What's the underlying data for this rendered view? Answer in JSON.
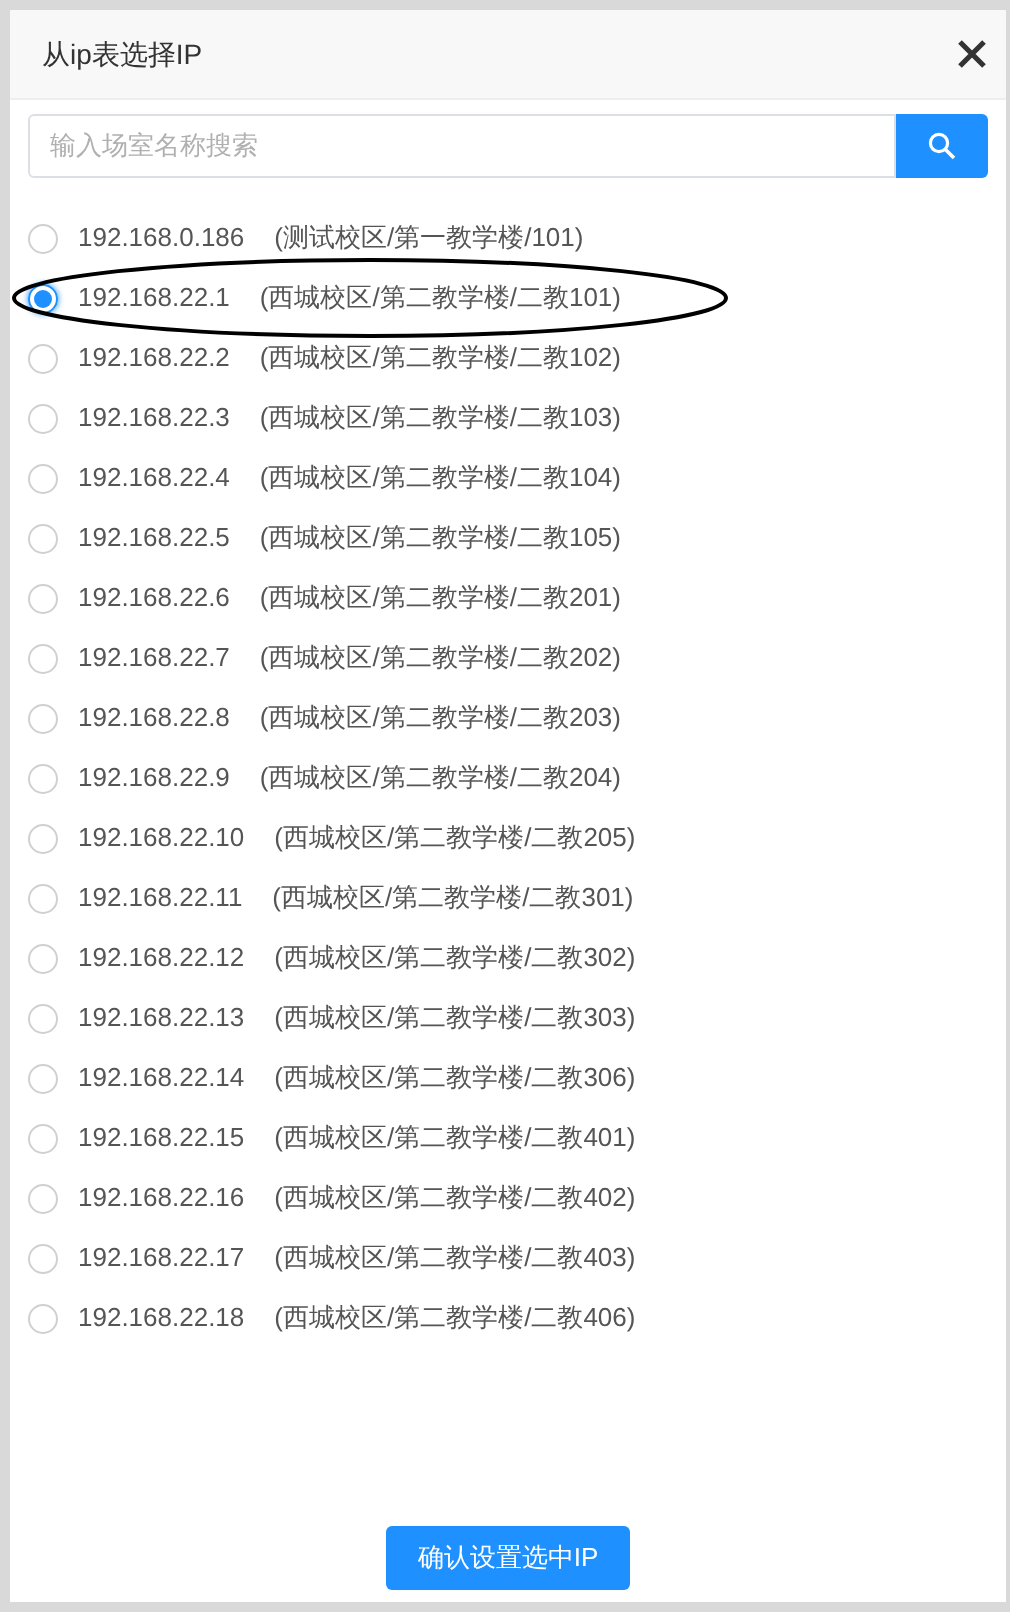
{
  "dialog": {
    "title": "从ip表选择IP",
    "search": {
      "placeholder": "输入场室名称搜索"
    },
    "options": [
      {
        "ip": "192.168.0.186",
        "location": "(测试校区/第一教学楼/101)",
        "selected": false
      },
      {
        "ip": "192.168.22.1",
        "location": "(西城校区/第二教学楼/二教101)",
        "selected": true
      },
      {
        "ip": "192.168.22.2",
        "location": "(西城校区/第二教学楼/二教102)",
        "selected": false
      },
      {
        "ip": "192.168.22.3",
        "location": "(西城校区/第二教学楼/二教103)",
        "selected": false
      },
      {
        "ip": "192.168.22.4",
        "location": "(西城校区/第二教学楼/二教104)",
        "selected": false
      },
      {
        "ip": "192.168.22.5",
        "location": "(西城校区/第二教学楼/二教105)",
        "selected": false
      },
      {
        "ip": "192.168.22.6",
        "location": "(西城校区/第二教学楼/二教201)",
        "selected": false
      },
      {
        "ip": "192.168.22.7",
        "location": "(西城校区/第二教学楼/二教202)",
        "selected": false
      },
      {
        "ip": "192.168.22.8",
        "location": "(西城校区/第二教学楼/二教203)",
        "selected": false
      },
      {
        "ip": "192.168.22.9",
        "location": "(西城校区/第二教学楼/二教204)",
        "selected": false
      },
      {
        "ip": "192.168.22.10",
        "location": "(西城校区/第二教学楼/二教205)",
        "selected": false
      },
      {
        "ip": "192.168.22.11",
        "location": "(西城校区/第二教学楼/二教301)",
        "selected": false
      },
      {
        "ip": "192.168.22.12",
        "location": "(西城校区/第二教学楼/二教302)",
        "selected": false
      },
      {
        "ip": "192.168.22.13",
        "location": "(西城校区/第二教学楼/二教303)",
        "selected": false
      },
      {
        "ip": "192.168.22.14",
        "location": "(西城校区/第二教学楼/二教306)",
        "selected": false
      },
      {
        "ip": "192.168.22.15",
        "location": "(西城校区/第二教学楼/二教401)",
        "selected": false
      },
      {
        "ip": "192.168.22.16",
        "location": "(西城校区/第二教学楼/二教402)",
        "selected": false
      },
      {
        "ip": "192.168.22.17",
        "location": "(西城校区/第二教学楼/二教403)",
        "selected": false
      },
      {
        "ip": "192.168.22.18",
        "location": "(西城校区/第二教学楼/二教406)",
        "selected": false
      }
    ],
    "confirm_button": "确认设置选中IP"
  }
}
